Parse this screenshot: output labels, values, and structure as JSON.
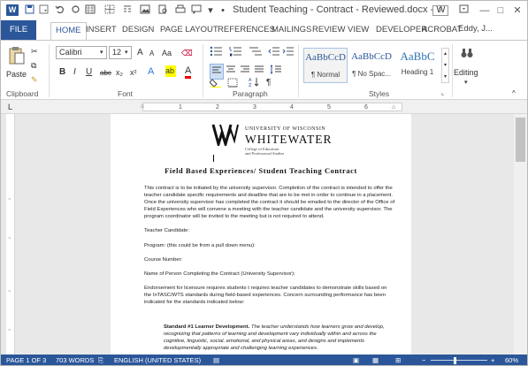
{
  "titlebar": {
    "app_icon": "W",
    "qat": [
      "save-icon",
      "undo-icon",
      "redo-icon",
      "customize-icon"
    ],
    "title": "Student Teaching - Contract - Reviewed.docx - W...",
    "window_controls": [
      "?",
      "restore-icon",
      "—",
      "□",
      "✕"
    ]
  },
  "tabs": [
    "FILE",
    "HOME",
    "INSERT",
    "DESIGN",
    "PAGE LAYOUT",
    "REFERENCES",
    "MAILINGS",
    "REVIEW",
    "VIEW",
    "DEVELOPER",
    "ACROBAT"
  ],
  "active_tab": "HOME",
  "user": "Eddy, J...",
  "ribbon": {
    "clipboard": {
      "paste": "Paste",
      "label": "Clipboard"
    },
    "font": {
      "name": "Calibri",
      "size": "12",
      "label": "Font",
      "bold": "B",
      "italic": "I",
      "underline": "U",
      "strike": "abc",
      "sub": "x₂",
      "sup": "x²",
      "grow": "A",
      "shrink": "A",
      "case": "Aa"
    },
    "paragraph": {
      "label": "Paragraph"
    },
    "styles": {
      "label": "Styles",
      "items": [
        {
          "preview": "AaBbCcD",
          "name": "¶ Normal"
        },
        {
          "preview": "AaBbCcD",
          "name": "¶ No Spac..."
        },
        {
          "preview": "AaBbC",
          "name": "Heading 1"
        }
      ]
    },
    "editing": {
      "label": "Editing"
    }
  },
  "ruler": {
    "numbers": [
      "1",
      "2",
      "3",
      "4",
      "5",
      "6"
    ]
  },
  "document": {
    "logo": {
      "line1": "UNIVERSITY OF WISCONSIN",
      "line2": "WHITEWATER",
      "line3": "College of Education",
      "line4": "and Professional Studies"
    },
    "title": "Field Based Experiences/ Student Teaching Contract",
    "para1": "This contract is to be initiated by the university supervisor.  Completion of the contract is intended to offer the teacher candidate specific requirements and deadline that are to be met in order to continue in a placement.  Once the university supervisor has completed the contract it should be emailed to the director of the Office of Field Experiences who will convene a meeting with the teacher candidate and the university supervisor.  The program coordinator will be invited to the meeting but is not required to attend.",
    "teacher_candidate": "Teacher Candidate:",
    "program": "Program:  (this could be from a pull down menu):",
    "course_number": "Course Number:",
    "person_completing": "Name of Person Completing the Contract (University Supervisor):",
    "endorsement": "Endorsement for licensure requires students t requires teacher candidates to demonstrate skills based on the InTASC/WTS standards during field-based experiences.  Concern surrounding performance has been indicated for the standards indicated below:",
    "standard_heading": "Standard #1 Learner Development.",
    "standard_text": " The teacher understands how learners grow and develop, recognizing that patterns of learning and development vary individually within and across the cognitive, linguistic, social, emotional, and physical areas, and designs and implements developmentally appropriate and challenging learning experiences."
  },
  "statusbar": {
    "page": "PAGE 1 OF 3",
    "words": "703 WORDS",
    "language": "ENGLISH (UNITED STATES)",
    "zoom": "60%",
    "zoom_level": 0.6
  },
  "colors": {
    "accent": "#2b579a",
    "ribbon_bg": "#ffffff",
    "doc_bg": "#e8e8e8"
  }
}
